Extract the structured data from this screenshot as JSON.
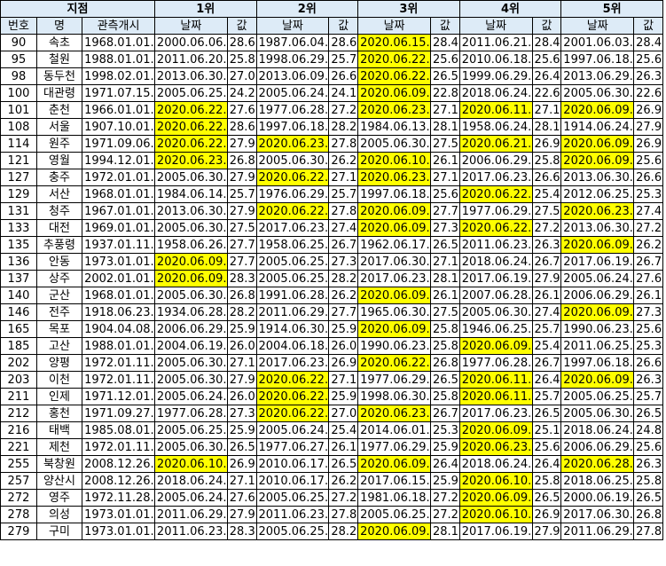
{
  "header": {
    "station": "지점",
    "ranks": [
      "1위",
      "2위",
      "3위",
      "4위",
      "5위"
    ],
    "col_no": "번호",
    "col_name": "명",
    "col_start": "관측개시",
    "col_date": "날짜",
    "col_val": "값"
  },
  "highlight_color": "#ffff00",
  "header_color": "#ddebf7",
  "rows": [
    {
      "no": "90",
      "name": "속초",
      "start": "1968.01.01.",
      "r": [
        [
          "2000.06.06.",
          "28.6",
          0
        ],
        [
          "1987.06.04.",
          "28.6",
          0
        ],
        [
          "2020.06.15.",
          "28.4",
          1
        ],
        [
          "2011.06.21.",
          "28.4",
          0
        ],
        [
          "2001.06.03.",
          "28.4",
          0
        ]
      ]
    },
    {
      "no": "95",
      "name": "철원",
      "start": "1988.01.01.",
      "r": [
        [
          "2011.06.20.",
          "25.8",
          0
        ],
        [
          "1998.06.29.",
          "25.7",
          0
        ],
        [
          "2020.06.22.",
          "25.6",
          1
        ],
        [
          "2010.06.18.",
          "25.6",
          0
        ],
        [
          "1997.06.18.",
          "25.6",
          0
        ]
      ]
    },
    {
      "no": "98",
      "name": "동두천",
      "start": "1998.02.01.",
      "r": [
        [
          "2013.06.30.",
          "27.0",
          0
        ],
        [
          "2013.06.09.",
          "26.6",
          0
        ],
        [
          "2020.06.22.",
          "26.5",
          1
        ],
        [
          "1999.06.29.",
          "26.4",
          0
        ],
        [
          "2013.06.29.",
          "26.3",
          0
        ]
      ]
    },
    {
      "no": "100",
      "name": "대관령",
      "start": "1971.07.15.",
      "r": [
        [
          "2005.06.25.",
          "24.2",
          0
        ],
        [
          "2005.06.24.",
          "24.1",
          0
        ],
        [
          "2020.06.09.",
          "22.8",
          1
        ],
        [
          "2018.06.24.",
          "22.6",
          0
        ],
        [
          "2005.06.30.",
          "22.6",
          0
        ]
      ]
    },
    {
      "no": "101",
      "name": "춘천",
      "start": "1966.01.01.",
      "r": [
        [
          "2020.06.22.",
          "27.6",
          1
        ],
        [
          "1977.06.28.",
          "27.2",
          0
        ],
        [
          "2020.06.23.",
          "27.1",
          1
        ],
        [
          "2020.06.11.",
          "27.1",
          1
        ],
        [
          "2020.06.09.",
          "26.9",
          1
        ]
      ]
    },
    {
      "no": "108",
      "name": "서울",
      "start": "1907.10.01.",
      "r": [
        [
          "2020.06.22.",
          "28.6",
          1
        ],
        [
          "1997.06.18.",
          "28.2",
          0
        ],
        [
          "1984.06.13.",
          "28.1",
          0
        ],
        [
          "1958.06.24.",
          "28.1",
          0
        ],
        [
          "1914.06.24.",
          "27.9",
          0
        ]
      ]
    },
    {
      "no": "114",
      "name": "원주",
      "start": "1971.09.06.",
      "r": [
        [
          "2020.06.22.",
          "27.9",
          1
        ],
        [
          "2020.06.23.",
          "27.8",
          1
        ],
        [
          "2005.06.30.",
          "27.5",
          0
        ],
        [
          "2020.06.21.",
          "26.9",
          1
        ],
        [
          "2020.06.09.",
          "26.9",
          1
        ]
      ]
    },
    {
      "no": "121",
      "name": "영월",
      "start": "1994.12.01.",
      "r": [
        [
          "2020.06.23.",
          "26.8",
          1
        ],
        [
          "2005.06.30.",
          "26.2",
          0
        ],
        [
          "2020.06.10.",
          "26.1",
          1
        ],
        [
          "2006.06.29.",
          "25.8",
          0
        ],
        [
          "2020.06.09.",
          "25.6",
          1
        ]
      ]
    },
    {
      "no": "127",
      "name": "충주",
      "start": "1972.01.01.",
      "r": [
        [
          "2005.06.30.",
          "27.9",
          0
        ],
        [
          "2020.06.22.",
          "27.1",
          1
        ],
        [
          "2020.06.23.",
          "27.1",
          1
        ],
        [
          "2017.06.23.",
          "26.6",
          0
        ],
        [
          "2013.06.30.",
          "26.6",
          0
        ]
      ]
    },
    {
      "no": "129",
      "name": "서산",
      "start": "1968.01.01.",
      "r": [
        [
          "1984.06.14.",
          "25.7",
          0
        ],
        [
          "1976.06.29.",
          "25.7",
          0
        ],
        [
          "1997.06.18.",
          "25.6",
          0
        ],
        [
          "2020.06.22.",
          "25.4",
          1
        ],
        [
          "2012.06.25.",
          "25.3",
          0
        ]
      ]
    },
    {
      "no": "131",
      "name": "청주",
      "start": "1967.01.01.",
      "r": [
        [
          "2013.06.30.",
          "27.9",
          0
        ],
        [
          "2020.06.22.",
          "27.8",
          1
        ],
        [
          "2020.06.09.",
          "27.7",
          1
        ],
        [
          "1977.06.29.",
          "27.5",
          0
        ],
        [
          "2020.06.23.",
          "27.4",
          1
        ]
      ]
    },
    {
      "no": "133",
      "name": "대전",
      "start": "1969.01.01.",
      "r": [
        [
          "2005.06.30.",
          "27.5",
          0
        ],
        [
          "2017.06.23.",
          "27.4",
          0
        ],
        [
          "2020.06.09.",
          "27.3",
          1
        ],
        [
          "2020.06.22.",
          "27.2",
          1
        ],
        [
          "2013.06.30.",
          "27.2",
          0
        ]
      ]
    },
    {
      "no": "135",
      "name": "추풍령",
      "start": "1937.01.11.",
      "r": [
        [
          "1958.06.26.",
          "27.7",
          0
        ],
        [
          "1958.06.25.",
          "26.7",
          0
        ],
        [
          "1962.06.17.",
          "26.5",
          0
        ],
        [
          "2011.06.23.",
          "26.3",
          0
        ],
        [
          "2020.06.09.",
          "26.2",
          1
        ]
      ]
    },
    {
      "no": "136",
      "name": "안동",
      "start": "1973.01.01.",
      "r": [
        [
          "2020.06.09.",
          "27.7",
          1
        ],
        [
          "2005.06.25.",
          "27.3",
          0
        ],
        [
          "2017.06.30.",
          "27.1",
          0
        ],
        [
          "2018.06.24.",
          "26.7",
          0
        ],
        [
          "2017.06.19.",
          "26.7",
          0
        ]
      ]
    },
    {
      "no": "137",
      "name": "상주",
      "start": "2002.01.01.",
      "r": [
        [
          "2020.06.09.",
          "28.3",
          1
        ],
        [
          "2005.06.25.",
          "28.2",
          0
        ],
        [
          "2017.06.23.",
          "28.1",
          0
        ],
        [
          "2017.06.19.",
          "27.9",
          0
        ],
        [
          "2005.06.24.",
          "27.6",
          0
        ]
      ]
    },
    {
      "no": "140",
      "name": "군산",
      "start": "1968.01.01.",
      "r": [
        [
          "2005.06.30.",
          "26.8",
          0
        ],
        [
          "1991.06.28.",
          "26.2",
          0
        ],
        [
          "2020.06.09.",
          "26.1",
          1
        ],
        [
          "2007.06.28.",
          "26.1",
          0
        ],
        [
          "2006.06.29.",
          "26.1",
          0
        ]
      ]
    },
    {
      "no": "146",
      "name": "전주",
      "start": "1918.06.23.",
      "r": [
        [
          "1934.06.28.",
          "28.2",
          0
        ],
        [
          "2011.06.29.",
          "27.7",
          0
        ],
        [
          "1965.06.30.",
          "27.5",
          0
        ],
        [
          "2005.06.30.",
          "27.4",
          0
        ],
        [
          "2020.06.09.",
          "27.3",
          1
        ]
      ]
    },
    {
      "no": "165",
      "name": "목포",
      "start": "1904.04.08.",
      "r": [
        [
          "2006.06.29.",
          "25.9",
          0
        ],
        [
          "1914.06.30.",
          "25.9",
          0
        ],
        [
          "2020.06.09.",
          "25.8",
          1
        ],
        [
          "1946.06.25.",
          "25.7",
          0
        ],
        [
          "1990.06.23.",
          "25.6",
          0
        ]
      ]
    },
    {
      "no": "185",
      "name": "고산",
      "start": "1988.01.01.",
      "r": [
        [
          "2004.06.19.",
          "26.0",
          0
        ],
        [
          "2004.06.18.",
          "26.0",
          0
        ],
        [
          "1990.06.23.",
          "25.8",
          0
        ],
        [
          "2020.06.09.",
          "25.4",
          1
        ],
        [
          "2011.06.25.",
          "25.3",
          0
        ]
      ]
    },
    {
      "no": "202",
      "name": "양평",
      "start": "1972.01.11.",
      "r": [
        [
          "2005.06.30.",
          "27.1",
          0
        ],
        [
          "2017.06.23.",
          "26.9",
          0
        ],
        [
          "2020.06.22.",
          "26.8",
          1
        ],
        [
          "1977.06.28.",
          "26.7",
          0
        ],
        [
          "1997.06.18.",
          "26.6",
          0
        ]
      ]
    },
    {
      "no": "203",
      "name": "이천",
      "start": "1972.01.11.",
      "r": [
        [
          "2005.06.30.",
          "27.9",
          0
        ],
        [
          "2020.06.22.",
          "27.1",
          1
        ],
        [
          "1977.06.29.",
          "26.5",
          0
        ],
        [
          "2020.06.11.",
          "26.4",
          1
        ],
        [
          "2020.06.09.",
          "26.3",
          1
        ]
      ]
    },
    {
      "no": "211",
      "name": "인제",
      "start": "1971.12.01.",
      "r": [
        [
          "2005.06.24.",
          "26.0",
          0
        ],
        [
          "2020.06.22.",
          "25.9",
          1
        ],
        [
          "1998.06.30.",
          "25.8",
          0
        ],
        [
          "2020.06.11.",
          "25.7",
          1
        ],
        [
          "2005.06.25.",
          "25.7",
          0
        ]
      ]
    },
    {
      "no": "212",
      "name": "홍천",
      "start": "1971.09.27.",
      "r": [
        [
          "1977.06.28.",
          "27.3",
          0
        ],
        [
          "2020.06.22.",
          "27.0",
          1
        ],
        [
          "2020.06.23.",
          "26.7",
          1
        ],
        [
          "2017.06.23.",
          "26.5",
          0
        ],
        [
          "2005.06.30.",
          "26.5",
          0
        ]
      ]
    },
    {
      "no": "216",
      "name": "태백",
      "start": "1985.08.01.",
      "r": [
        [
          "2005.06.25.",
          "25.9",
          0
        ],
        [
          "2005.06.24.",
          "25.4",
          0
        ],
        [
          "2014.06.01.",
          "25.3",
          0
        ],
        [
          "2020.06.09.",
          "25.1",
          1
        ],
        [
          "2018.06.24.",
          "24.8",
          0
        ]
      ]
    },
    {
      "no": "221",
      "name": "제천",
      "start": "1972.01.11.",
      "r": [
        [
          "2005.06.30.",
          "26.5",
          0
        ],
        [
          "1977.06.27.",
          "26.1",
          0
        ],
        [
          "1977.06.29.",
          "25.9",
          0
        ],
        [
          "2020.06.23.",
          "25.6",
          1
        ],
        [
          "2006.06.29.",
          "25.6",
          0
        ]
      ]
    },
    {
      "no": "255",
      "name": "북창원",
      "start": "2008.12.26.",
      "r": [
        [
          "2020.06.10.",
          "26.9",
          1
        ],
        [
          "2010.06.17.",
          "26.5",
          0
        ],
        [
          "2020.06.09.",
          "26.4",
          1
        ],
        [
          "2018.06.24.",
          "26.4",
          0
        ],
        [
          "2020.06.28.",
          "26.3",
          1
        ]
      ]
    },
    {
      "no": "257",
      "name": "양산시",
      "start": "2008.12.26.",
      "r": [
        [
          "2018.06.24.",
          "27.1",
          0
        ],
        [
          "2010.06.17.",
          "26.2",
          0
        ],
        [
          "2017.06.15.",
          "25.9",
          0
        ],
        [
          "2020.06.10.",
          "25.8",
          1
        ],
        [
          "2018.06.25.",
          "25.8",
          0
        ]
      ]
    },
    {
      "no": "272",
      "name": "영주",
      "start": "1972.11.28.",
      "r": [
        [
          "2005.06.24.",
          "27.6",
          0
        ],
        [
          "2005.06.25.",
          "27.2",
          0
        ],
        [
          "1981.06.18.",
          "27.2",
          0
        ],
        [
          "2020.06.09.",
          "26.5",
          1
        ],
        [
          "2000.06.19.",
          "26.5",
          0
        ]
      ]
    },
    {
      "no": "278",
      "name": "의성",
      "start": "1973.01.01.",
      "r": [
        [
          "2011.06.29.",
          "27.9",
          0
        ],
        [
          "2011.06.23.",
          "27.8",
          0
        ],
        [
          "2005.06.25.",
          "27.2",
          0
        ],
        [
          "2020.06.10.",
          "26.9",
          1
        ],
        [
          "2017.06.30.",
          "26.8",
          0
        ]
      ]
    },
    {
      "no": "279",
      "name": "구미",
      "start": "1973.01.01.",
      "r": [
        [
          "2011.06.23.",
          "28.3",
          0
        ],
        [
          "2005.06.25.",
          "28.2",
          0
        ],
        [
          "2020.06.09.",
          "28.1",
          1
        ],
        [
          "2017.06.19.",
          "27.9",
          0
        ],
        [
          "2011.06.29.",
          "27.8",
          0
        ]
      ]
    }
  ]
}
